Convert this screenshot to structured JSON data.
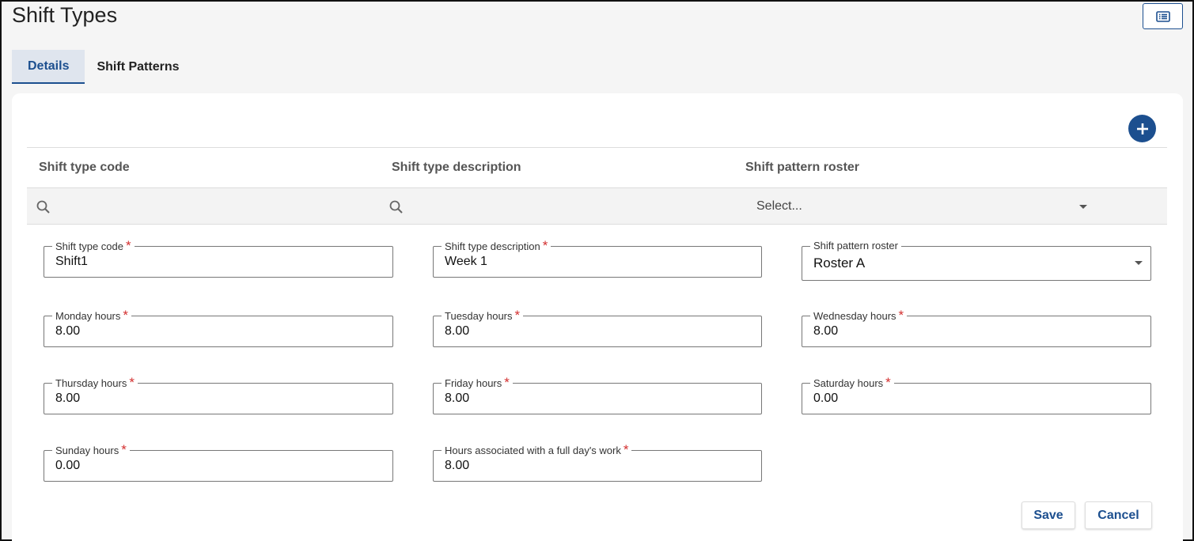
{
  "page": {
    "title": "Shift Types"
  },
  "tabs": [
    {
      "label": "Details",
      "active": true
    },
    {
      "label": "Shift Patterns",
      "active": false
    }
  ],
  "grid": {
    "columns": [
      "Shift type code",
      "Shift type description",
      "Shift pattern roster"
    ],
    "filters": {
      "roster_placeholder": "Select..."
    }
  },
  "form": {
    "shift_type_code": {
      "label": "Shift type code",
      "value": "Shift1",
      "required": "*"
    },
    "shift_type_description": {
      "label": "Shift type description",
      "value": "Week 1",
      "required": "*"
    },
    "shift_pattern_roster": {
      "label": "Shift pattern roster",
      "value": "Roster A"
    },
    "monday": {
      "label": "Monday hours",
      "value": "8.00",
      "required": "*"
    },
    "tuesday": {
      "label": "Tuesday hours",
      "value": "8.00",
      "required": "*"
    },
    "wednesday": {
      "label": "Wednesday hours",
      "value": "8.00",
      "required": "*"
    },
    "thursday": {
      "label": "Thursday hours",
      "value": "8.00",
      "required": "*"
    },
    "friday": {
      "label": "Friday hours",
      "value": "8.00",
      "required": "*"
    },
    "saturday": {
      "label": "Saturday hours",
      "value": "0.00",
      "required": "*"
    },
    "sunday": {
      "label": "Sunday hours",
      "value": "0.00",
      "required": "*"
    },
    "full_day": {
      "label": "Hours associated with a full day's work",
      "value": "8.00",
      "required": "*"
    }
  },
  "actions": {
    "save": "Save",
    "cancel": "Cancel"
  },
  "colors": {
    "accent": "#1c4f8f",
    "required": "#d32f2f"
  }
}
